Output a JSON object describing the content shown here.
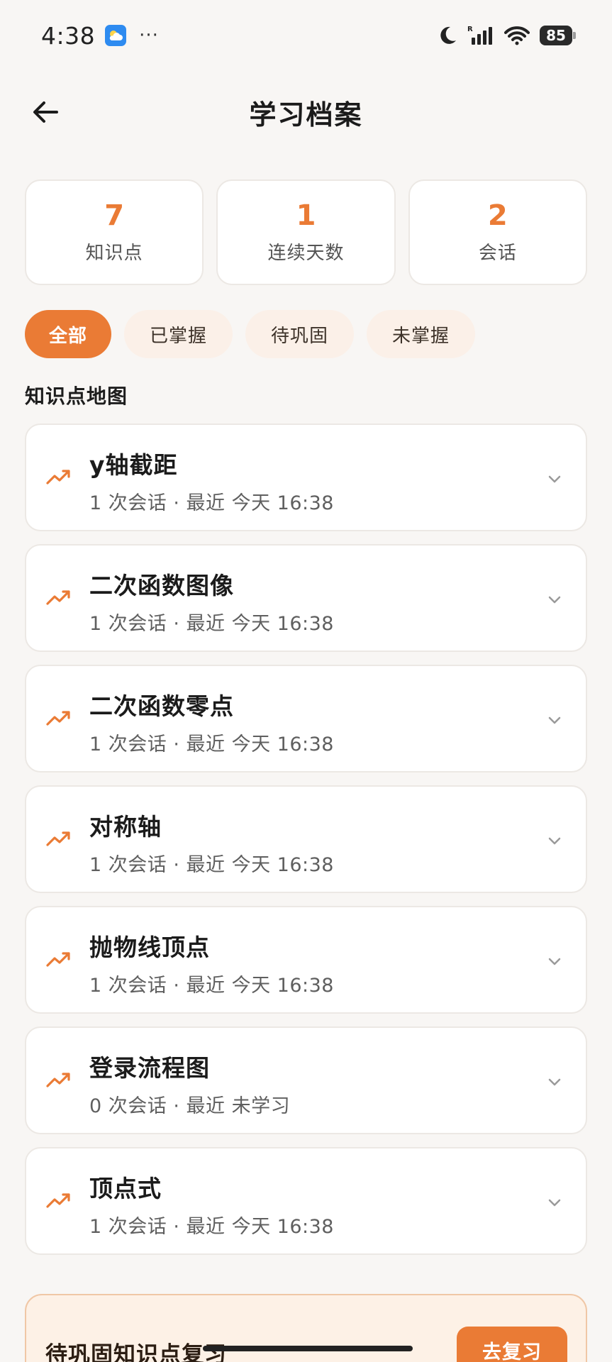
{
  "status_bar": {
    "time": "4:38",
    "dots": "···",
    "battery": "85",
    "icons": [
      "weather-icon",
      "moon-icon",
      "signal-icon",
      "wifi-icon",
      "battery-icon"
    ]
  },
  "header": {
    "title": "学习档案",
    "back_icon": "arrow-left-icon"
  },
  "stats": [
    {
      "value": "7",
      "label": "知识点"
    },
    {
      "value": "1",
      "label": "连续天数"
    },
    {
      "value": "2",
      "label": "会话"
    }
  ],
  "filters": [
    {
      "label": "全部",
      "active": true
    },
    {
      "label": "已掌握",
      "active": false
    },
    {
      "label": "待巩固",
      "active": false
    },
    {
      "label": "未掌握",
      "active": false
    }
  ],
  "section_title": "知识点地图",
  "knowledge_points": [
    {
      "name": "y轴截距",
      "meta": "1 次会话 · 最近 今天 16:38"
    },
    {
      "name": "二次函数图像",
      "meta": "1 次会话 · 最近 今天 16:38"
    },
    {
      "name": "二次函数零点",
      "meta": "1 次会话 · 最近 今天 16:38"
    },
    {
      "name": "对称轴",
      "meta": "1 次会话 · 最近 今天 16:38"
    },
    {
      "name": "抛物线顶点",
      "meta": "1 次会话 · 最近 今天 16:38"
    },
    {
      "name": "登录流程图",
      "meta": "0 次会话 · 最近 未学习"
    },
    {
      "name": "顶点式",
      "meta": "1 次会话 · 最近 今天 16:38"
    }
  ],
  "review": {
    "title": "待巩固知识点复习",
    "button": "去复习"
  },
  "colors": {
    "accent": "#ea7b35",
    "chip_bg": "#fbf0e8",
    "background": "#f8f6f4",
    "card_border": "#ece8e4"
  }
}
